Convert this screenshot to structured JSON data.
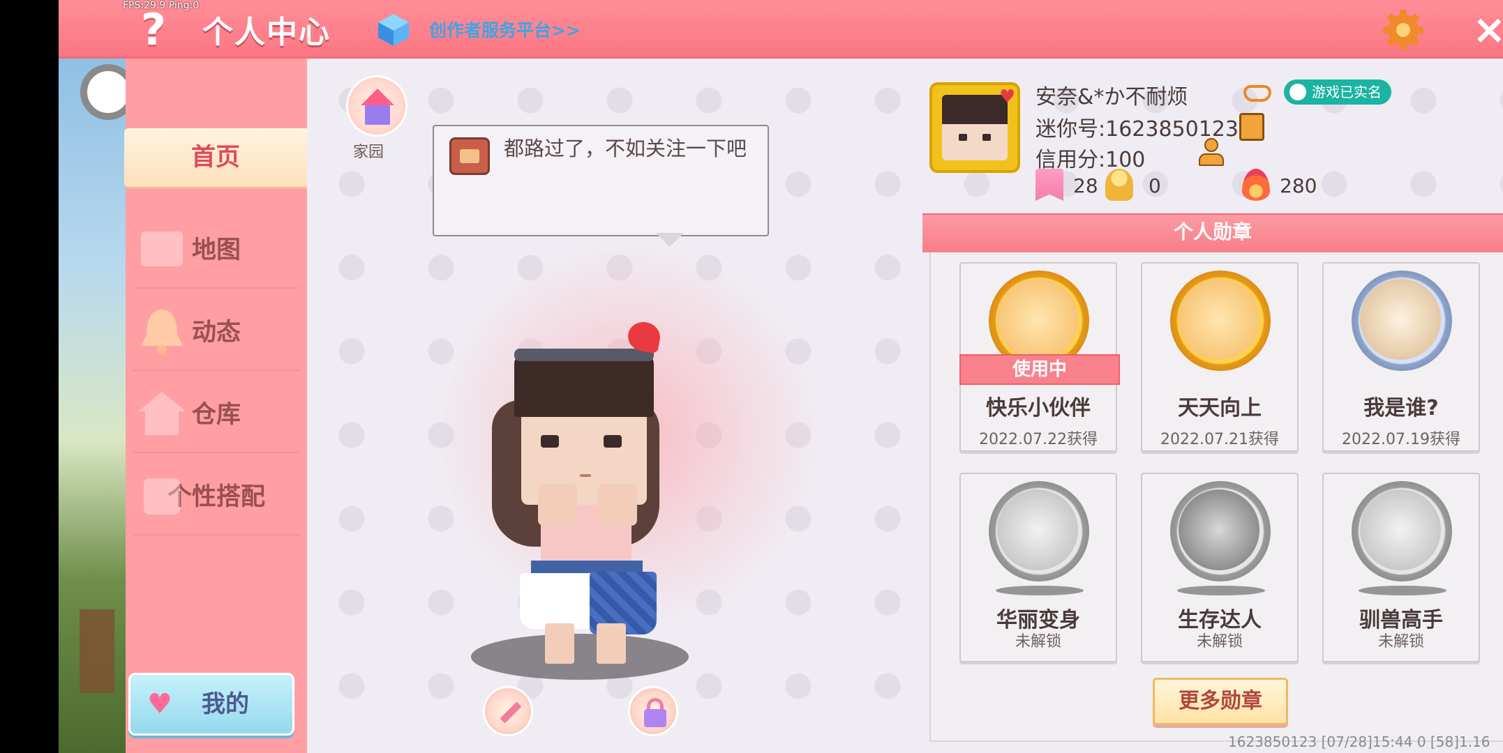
{
  "overlay": {
    "fps_text": "FPS:29.9  Ping:0"
  },
  "topbar": {
    "help_label": "?",
    "title": "个人中心",
    "creator_link": "创作者服务平台>>",
    "close_label": "×"
  },
  "sidebar": {
    "items": [
      {
        "label": "首页",
        "active": true
      },
      {
        "label": "地图"
      },
      {
        "label": "动态"
      },
      {
        "label": "仓库"
      },
      {
        "label": "个性搭配"
      }
    ],
    "mine_label": "我的"
  },
  "main": {
    "home_label": "家园",
    "speech_bubble": "都路过了，不如关注一下吧"
  },
  "profile": {
    "nickname": "安奈&*か不耐烦",
    "verified_label": "游戏已实名",
    "mini_id": "迷你号:1623850123",
    "credit": "信用分:100",
    "stats": [
      {
        "icon": "bookmark-plus-icon",
        "value": "28"
      },
      {
        "icon": "trophy-person-icon",
        "value": "0"
      },
      {
        "icon": "flame-icon",
        "value": "280"
      }
    ]
  },
  "badges": {
    "header": "个人勋章",
    "in_use_label": "使用中",
    "items": [
      {
        "name": "快乐小伙伴",
        "sub": "2022.07.22获得",
        "in_use": true
      },
      {
        "name": "天天向上",
        "sub": "2022.07.21获得"
      },
      {
        "name": "我是谁?",
        "sub": "2022.07.19获得"
      },
      {
        "name": "华丽变身",
        "sub": "未解锁"
      },
      {
        "name": "生存达人",
        "sub": "未解锁"
      },
      {
        "name": "驯兽高手",
        "sub": "未解锁"
      }
    ],
    "more_label": "更多勋章"
  },
  "footer": {
    "info": "1623850123   [07/28]15:44 0   [58]1.16"
  },
  "colors": {
    "accent_pink": "#fb7783",
    "sidebar_pink": "#ff9fa4",
    "verified_teal": "#1bb3a2",
    "in_use_red": "#f8828c"
  }
}
